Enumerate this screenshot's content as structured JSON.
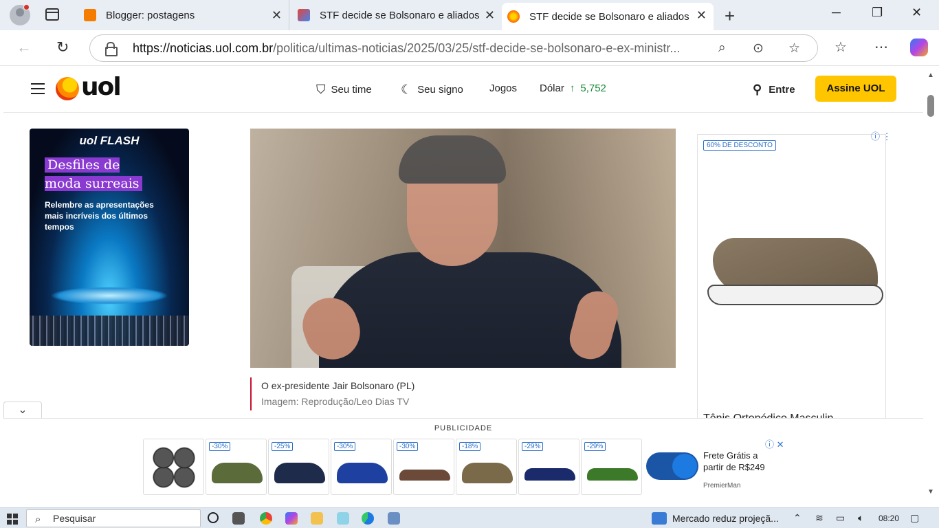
{
  "browser": {
    "tabs": [
      {
        "title": "Blogger: postagens",
        "favicon_color": "#f57c00"
      },
      {
        "title": "STF decide se Bolsonaro e aliados",
        "favicon_color": "#ea4335"
      },
      {
        "title": "STF decide se Bolsonaro e aliados",
        "favicon_color": "#f5a623",
        "active": true
      }
    ],
    "url_domain": "https://noticias.uol.com.br",
    "url_path": "/politica/ultimas-noticias/2025/03/25/stf-decide-se-bolsonaro-e-ex-ministr..."
  },
  "header": {
    "logo": "uol",
    "nav": [
      {
        "label": "Seu time",
        "icon": "shield-icon"
      },
      {
        "label": "Seu signo",
        "icon": "moon-icon"
      },
      {
        "label": "Jogos"
      },
      {
        "label": "Dólar"
      }
    ],
    "dolar_value": "5,752",
    "dolar_trend": "↑",
    "login_label": "Entre",
    "subscribe_label": "Assine UOL"
  },
  "left_ad": {
    "brand": "uol FLASH",
    "headline": "Desfiles de moda surreais",
    "subtext": "Relembre as apresentações mais incríveis dos últimos tempos"
  },
  "article": {
    "caption": "O ex-presidente Jair Bolsonaro (PL)",
    "credit": "Imagem: Reprodução/Leo Dias TV"
  },
  "right_ad": {
    "badge": "60% DE DESCONTO",
    "title": "Tênis Ortopédico Masculin"
  },
  "bottom_ad": {
    "label": "PUBLICIDADE",
    "products": [
      {
        "discount": "",
        "color": "#333"
      },
      {
        "discount": "-30%",
        "color": "#5b6b3a"
      },
      {
        "discount": "-25%",
        "color": "#1f2b4a"
      },
      {
        "discount": "-30%",
        "color": "#1e40a0"
      },
      {
        "discount": "-30%",
        "color": "#6b4a3a"
      },
      {
        "discount": "-18%",
        "color": "#7a6a4a"
      },
      {
        "discount": "-29%",
        "color": "#1a2a6a"
      },
      {
        "discount": "-29%",
        "color": "#3c7a2a"
      }
    ],
    "offer": "Frete Grátis a partir de R$249",
    "brand": "PremierMan"
  },
  "taskbar": {
    "search_placeholder": "Pesquisar",
    "news": "Mercado reduz projeçã...",
    "time": "08:20"
  }
}
